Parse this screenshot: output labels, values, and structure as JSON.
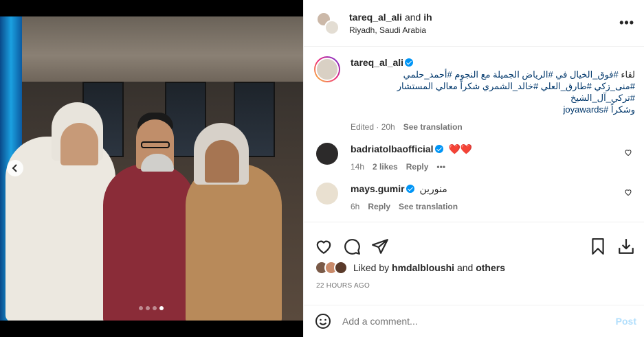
{
  "post": {
    "header": {
      "username": "tareq_al_ali",
      "conjunction": "and",
      "collaborator": "ih",
      "location": "Riyadh, Saudi Arabia",
      "more_icon": "more-horizontal-icon"
    },
    "caption": {
      "username": "tareq_al_ali",
      "line1_plain": "لقاء",
      "line1_tags": "#فوق_الخيال في #الرياض الجميلة مع النجوم #أحمد_حلمي",
      "line2": "#منى_زكي #طارق_العلي #خالد_الشمري شكراً معالي المستشار #تركي_آل_الشيخ",
      "line3": "وشكراً #joyawards",
      "edited": "Edited",
      "time": "20h",
      "see_translation": "See translation"
    },
    "comments": [
      {
        "username": "badriatolbaofficial",
        "verified": true,
        "text": "❤️❤️",
        "time": "14h",
        "likes": "2 likes",
        "reply": "Reply",
        "more": "•••"
      },
      {
        "username": "mays.gumir",
        "verified": true,
        "text": "منورين",
        "time": "6h",
        "reply": "Reply",
        "see_translation": "See translation"
      }
    ],
    "actions": {
      "like_icon": "heart-icon",
      "comment_icon": "comment-icon",
      "share_icon": "send-icon",
      "save_icon": "bookmark-icon",
      "download_icon": "download-icon"
    },
    "likes": {
      "prefix": "Liked by",
      "user": "hmdalbloushi",
      "and": "and",
      "others": "others"
    },
    "timestamp": "22 HOURS AGO",
    "add_comment": {
      "placeholder": "Add a comment...",
      "post_label": "Post"
    },
    "carousel": {
      "total_slides": 4,
      "active_slide": 4
    },
    "colors": {
      "verified": "#0095f6",
      "link": "#00376b",
      "post_button_disabled": "#b2dffc",
      "muted": "#737373"
    }
  }
}
